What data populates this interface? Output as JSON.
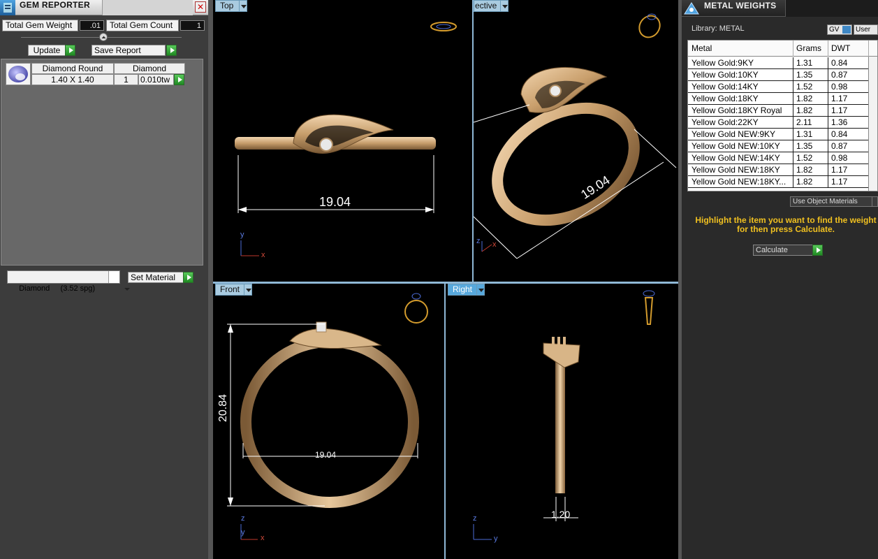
{
  "gem_reporter": {
    "title": "GEM REPORTER",
    "total_gem_weight_label": "Total Gem Weight",
    "total_gem_weight_value": ".01",
    "total_gem_count_label": "Total Gem Count",
    "total_gem_count_value": "1",
    "update_label": "Update",
    "save_report_label": "Save Report",
    "gem_row": {
      "shape_header": "Diamond Round",
      "material_header": "Diamond",
      "size": "1.40 X 1.40",
      "count": "1",
      "weight": "0.010tw"
    },
    "material_select": "Diamond     (3.52 spg)",
    "set_material_label": "Set Material"
  },
  "viewports": {
    "top": {
      "label": "Top",
      "dimension": "19.04",
      "axes": [
        "y",
        "x"
      ]
    },
    "perspective": {
      "label": "ective",
      "dimension": "19.04",
      "axes": [
        "z",
        "x"
      ]
    },
    "front": {
      "label": "Front",
      "height_dimension": "20.84",
      "width_dimension": "19.04",
      "axes": [
        "z",
        "y",
        "x"
      ]
    },
    "right": {
      "label": "Right",
      "dimension": "1.20",
      "axes": [
        "z",
        "y"
      ]
    }
  },
  "metal_weights": {
    "title": "METAL WEIGHTS",
    "library_label": "Library: METAL",
    "gv_label": "GV",
    "user_label": "User",
    "columns": [
      "Metal",
      "Grams",
      "DWT"
    ],
    "rows": [
      {
        "metal": "Yellow Gold:9KY",
        "grams": "1.31",
        "dwt": "0.84"
      },
      {
        "metal": "Yellow Gold:10KY",
        "grams": "1.35",
        "dwt": "0.87"
      },
      {
        "metal": "Yellow Gold:14KY",
        "grams": "1.52",
        "dwt": "0.98"
      },
      {
        "metal": "Yellow Gold:18KY",
        "grams": "1.82",
        "dwt": "1.17"
      },
      {
        "metal": "Yellow Gold:18KY Royal",
        "grams": "1.82",
        "dwt": "1.17"
      },
      {
        "metal": "Yellow Gold:22KY",
        "grams": "2.11",
        "dwt": "1.36"
      },
      {
        "metal": "Yellow Gold NEW:9KY",
        "grams": "1.31",
        "dwt": "0.84"
      },
      {
        "metal": "Yellow Gold NEW:10KY",
        "grams": "1.35",
        "dwt": "0.87"
      },
      {
        "metal": "Yellow Gold NEW:14KY",
        "grams": "1.52",
        "dwt": "0.98"
      },
      {
        "metal": "Yellow Gold NEW:18KY",
        "grams": "1.82",
        "dwt": "1.17"
      },
      {
        "metal": "Yellow Gold NEW:18KY...",
        "grams": "1.82",
        "dwt": "1.17"
      }
    ],
    "use_object_materials_label": "Use Object Materials",
    "hint": "Highlight the item you want to find the weight for then press Calculate.",
    "calculate_label": "Calculate"
  },
  "colors": {
    "gold": "#c9a57a",
    "hint_yellow": "#f0c020",
    "tab_active": "#57a8dc"
  }
}
